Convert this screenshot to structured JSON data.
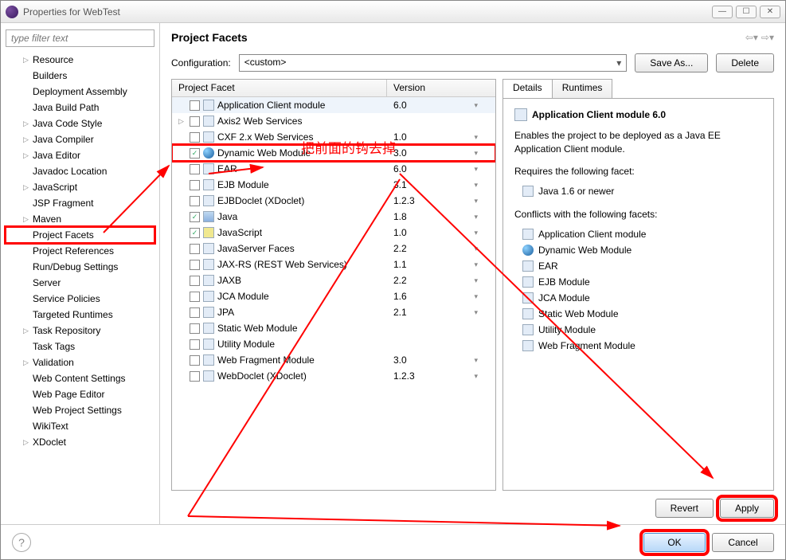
{
  "window_title": "Properties for WebTest",
  "filter_placeholder": "type filter text",
  "sidebar_items": [
    {
      "label": "Resource",
      "expandable": true
    },
    {
      "label": "Builders"
    },
    {
      "label": "Deployment Assembly"
    },
    {
      "label": "Java Build Path"
    },
    {
      "label": "Java Code Style",
      "expandable": true
    },
    {
      "label": "Java Compiler",
      "expandable": true
    },
    {
      "label": "Java Editor",
      "expandable": true
    },
    {
      "label": "Javadoc Location"
    },
    {
      "label": "JavaScript",
      "expandable": true
    },
    {
      "label": "JSP Fragment"
    },
    {
      "label": "Maven",
      "expandable": true
    },
    {
      "label": "Project Facets",
      "highlight": true
    },
    {
      "label": "Project References"
    },
    {
      "label": "Run/Debug Settings"
    },
    {
      "label": "Server"
    },
    {
      "label": "Service Policies"
    },
    {
      "label": "Targeted Runtimes"
    },
    {
      "label": "Task Repository",
      "expandable": true
    },
    {
      "label": "Task Tags"
    },
    {
      "label": "Validation",
      "expandable": true
    },
    {
      "label": "Web Content Settings"
    },
    {
      "label": "Web Page Editor"
    },
    {
      "label": "Web Project Settings"
    },
    {
      "label": "WikiText"
    },
    {
      "label": "XDoclet",
      "expandable": true
    }
  ],
  "main_title": "Project Facets",
  "config_label": "Configuration:",
  "config_value": "<custom>",
  "save_as": "Save As...",
  "delete": "Delete",
  "col_facet": "Project Facet",
  "col_version": "Version",
  "facets": [
    {
      "name": "Application Client module",
      "version": "6.0",
      "checked": false,
      "selected": true
    },
    {
      "name": "Axis2 Web Services",
      "version": "",
      "checked": false,
      "expandable": true
    },
    {
      "name": "CXF 2.x Web Services",
      "version": "1.0",
      "checked": false
    },
    {
      "name": "Dynamic Web Module",
      "version": "3.0",
      "checked": true,
      "highlight": true,
      "globe": true
    },
    {
      "name": "EAR",
      "version": "6.0",
      "checked": false
    },
    {
      "name": "EJB Module",
      "version": "3.1",
      "checked": false
    },
    {
      "name": "EJBDoclet (XDoclet)",
      "version": "1.2.3",
      "checked": false
    },
    {
      "name": "Java",
      "version": "1.8",
      "checked": true,
      "java": true
    },
    {
      "name": "JavaScript",
      "version": "1.0",
      "checked": true,
      "js": true
    },
    {
      "name": "JavaServer Faces",
      "version": "2.2",
      "checked": false
    },
    {
      "name": "JAX-RS (REST Web Services)",
      "version": "1.1",
      "checked": false
    },
    {
      "name": "JAXB",
      "version": "2.2",
      "checked": false
    },
    {
      "name": "JCA Module",
      "version": "1.6",
      "checked": false
    },
    {
      "name": "JPA",
      "version": "2.1",
      "checked": false
    },
    {
      "name": "Static Web Module",
      "version": "",
      "checked": false
    },
    {
      "name": "Utility Module",
      "version": "",
      "checked": false
    },
    {
      "name": "Web Fragment Module",
      "version": "3.0",
      "checked": false
    },
    {
      "name": "WebDoclet (XDoclet)",
      "version": "1.2.3",
      "checked": false
    }
  ],
  "tabs": {
    "details": "Details",
    "runtimes": "Runtimes"
  },
  "details": {
    "title": "Application Client module 6.0",
    "desc": "Enables the project to be deployed as a Java EE Application Client module.",
    "requires": "Requires the following facet:",
    "req_items": [
      "Java 1.6 or newer"
    ],
    "conflicts": "Conflicts with the following facets:",
    "conf_items": [
      {
        "label": "Application Client module"
      },
      {
        "label": "Dynamic Web Module",
        "globe": true
      },
      {
        "label": "EAR"
      },
      {
        "label": "EJB Module"
      },
      {
        "label": "JCA Module"
      },
      {
        "label": "Static Web Module"
      },
      {
        "label": "Utility Module"
      },
      {
        "label": "Web Fragment Module"
      }
    ]
  },
  "buttons": {
    "revert": "Revert",
    "apply": "Apply",
    "ok": "OK",
    "cancel": "Cancel"
  },
  "annotation": "把前面的钩去掉"
}
